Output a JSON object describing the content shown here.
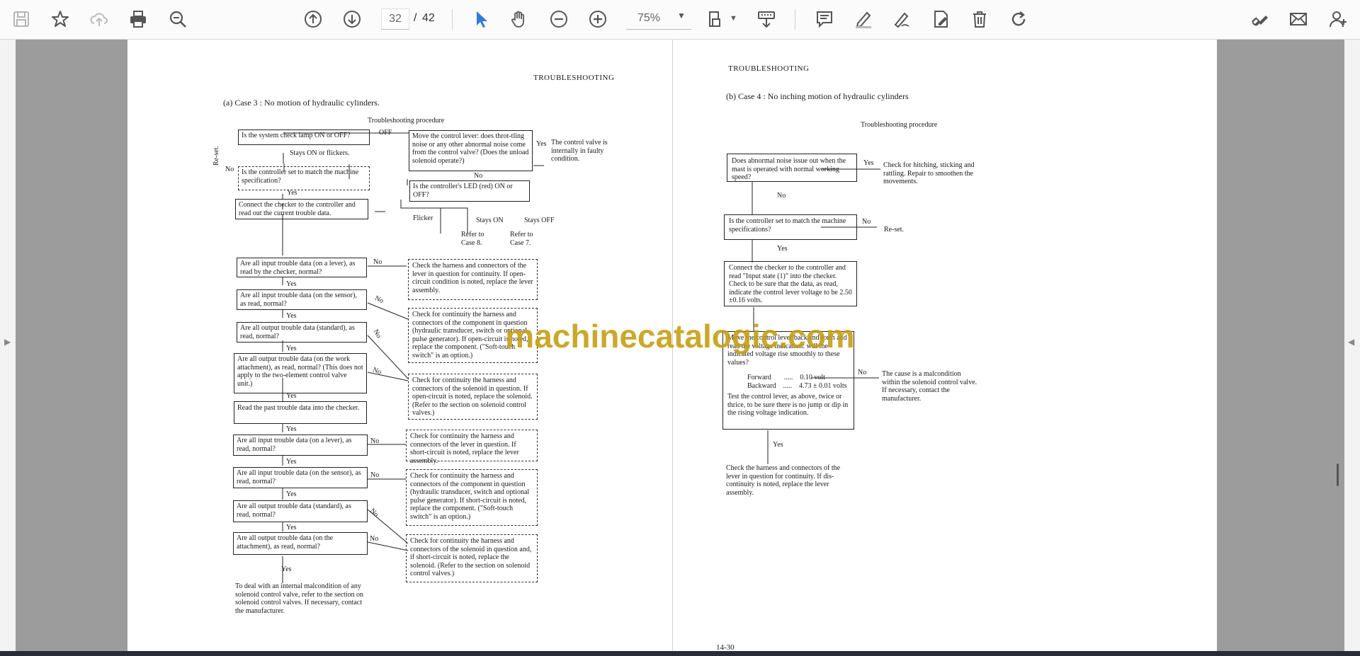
{
  "toolbar": {
    "page_current": "32",
    "page_sep": "/",
    "page_total": "42",
    "zoom_value": "75%",
    "accent_color": "#2f7bd8"
  },
  "watermark": "machinecatalogic.com",
  "left_page": {
    "header": "TROUBLESHOOTING",
    "case_title": "(a)   Case 3 :  No motion of hydraulic cylinders.",
    "proc_title": "Troubleshooting procedure",
    "q1": "Is the system check lamp ON or OFF?",
    "off": "OFF",
    "stays_on_flickers": "Stays ON or flickers.",
    "move_lever": "Move the control lever: does throt-tling noise or any other abnormal noise come from the control valve? (Does the unload solenoid operate?)",
    "yes": "Yes",
    "valve_faulty": "The control valve is internally in faulty condition.",
    "no": "No",
    "reset": "Re-set.",
    "controller_set": "Is the controller set to match the machine specification?",
    "led_on_off": "Is the controller's LED (red) ON or OFF?",
    "connect_checker": "Connect the checker to the controller and read out the current trouble data.",
    "flicker": "Flicker",
    "stays_on": "Stays ON",
    "stays_off": "Stays OFF",
    "refer_case8": "Refer to Case 8.",
    "refer_case7": "Refer to Case 7.",
    "in1": "Are all input trouble data (on a lever), as read by the checker, normal?",
    "in1_ans": "Check the harness and connectors of the lever in question for continuity. If open-circuit condition is noted, replace the lever assembly.",
    "in2": "Are all input trouble data (on the sensor), as read, normal?",
    "in2_ans": "Check for continuity the harness and connectors of the component in question (hydraulic transducer, switch or optional pulse generator). If open-circuit is noted, replace the component. (\"Soft-touch switch\" is an option.)",
    "out1": "Are all output trouble data (standard), as read, normal?",
    "out2": "Are all output trouble data (on the work attachment), as read, normal? (This does not apply to the two-element control valve unit.)",
    "out_ans": "Check for continuity the harness and connectors of the solenoid in question. If open-circuit is noted, replace the solenoid. (Refer to the section on solenoid control valves.)",
    "past": "Read the past trouble data into the checker.",
    "p_in1": "Are all input trouble data (on a lever), as read, normal?",
    "p_in1_ans": "Check for continuity the harness and connectors of the lever in question. If short-circuit is noted, replace the lever assembly.",
    "p_in2": "Are all input trouble data (on the sensor), as read, normal?",
    "p_in2_ans": "Check for continuity the harness and connectors of the component in question (hydraulic transducer, switch and optional pulse generator). If short-circuit is noted, replace the component. (\"Soft-touch switch\" is an option.)",
    "p_out1": "Are all output trouble data (standard), as read, normal?",
    "p_out2": "Are all output trouble data (on the attachment), as read, normal?",
    "p_out_ans": "Check for continuity the harness and connectors of the solenoid in question and, if short-circuit is noted, replace the solenoid. (Refer to the section on solenoid control valves.)",
    "final": "To deal with an internal malcondition of any solenoid control valve, refer to the section on solenoid control valves. If necessary, contact the manufacturer."
  },
  "right_page": {
    "header": "TROUBLESHOOTING",
    "case_title": "(b)   Case 4 :  No inching motion of hydraulic cylinders",
    "proc_title": "Troubleshooting procedure",
    "q1": "Does abnormal noise issue out when the mast is operated with normal working speed?",
    "yes": "Yes",
    "no": "No",
    "a1": "Check for hitching, sticking and rattling. Repair to smoothen the movements.",
    "q2": "Is the controller set to match the machine specifications?",
    "reset": "Re-set.",
    "q3": "Connect the checker to the controller and read \"Input state (1)\" into the checker. Check to be sure that the data, as read, indicate the control lever voltage to be 2.50 ±0.16 volts.",
    "q4a": "Move the control lever back and forth and read the voltage indication: will the indicated voltage rise smoothly to these values?",
    "forward": "Forward",
    "forward_val": "0.10 volt",
    "backward": "Backward",
    "backward_val": "4.73 ± 0.01 volts",
    "q4b": "Test the control lever, as above, twice or thrice, to be sure there is no jump or dip in the rising voltage indication.",
    "a4": "The cause is a malcondition within the solenoid control valve. If necessary, contact the manufacturer.",
    "final": "Check the harness and connectors of the lever in question for continuity. If dis-continuity is noted, replace the lever assembly.",
    "page_no": "14-30"
  }
}
